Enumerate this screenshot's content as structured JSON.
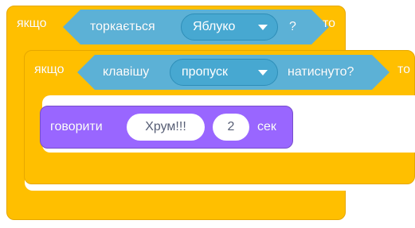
{
  "outer_if": {
    "if_label": "якщо",
    "then_label": "то",
    "condition": {
      "label": "торкається",
      "dropdown_value": "Яблуко",
      "question_mark": "?"
    }
  },
  "inner_if": {
    "if_label": "якщо",
    "then_label": "то",
    "condition": {
      "label": "клавішу",
      "dropdown_value": "пропуск",
      "pressed_label": "натиснуто?"
    }
  },
  "say_block": {
    "label": "говорити",
    "message": "Хрум!!!",
    "seconds": "2",
    "unit": "сек"
  },
  "colors": {
    "control": "#ffbf00",
    "sensing": "#5cb1d6",
    "looks": "#9966ff"
  }
}
